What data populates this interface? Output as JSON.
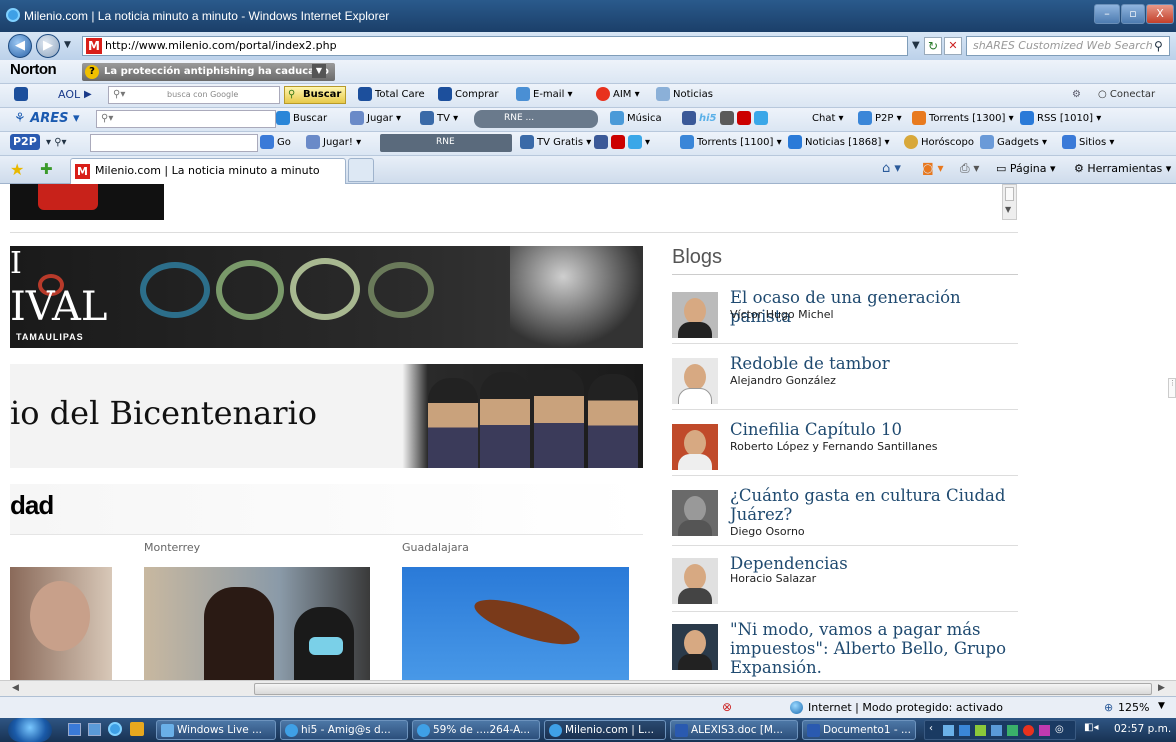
{
  "window": {
    "title": "Milenio.com | La noticia minuto a minuto - Windows Internet Explorer",
    "controls": [
      "–",
      "▫",
      "X"
    ]
  },
  "address": {
    "url": "http://www.milenio.com/portal/index2.php",
    "search_placeholder": "shARES Customized Web Search"
  },
  "toolbars": {
    "norton": {
      "brand": "Norton",
      "alert": "La protección antiphishing ha caducado"
    },
    "aol": {
      "brand": "AOL",
      "search_hint": "busca con Google",
      "search_button": "Buscar",
      "items": [
        "Total Care",
        "Comprar",
        "E-mail",
        "AIM",
        "Noticias"
      ],
      "connect": "Conectar"
    },
    "ares": {
      "brand": "ARES",
      "items": [
        "Buscar",
        "Jugar",
        "TV",
        "RNE ...",
        "Música",
        "Chat",
        "P2P",
        "Torrents [1300]",
        "RSS [1010]"
      ]
    },
    "p2p": {
      "brand": "P2P",
      "items": [
        "Go",
        "Jugar!",
        "RNE",
        "TV Gratis",
        "Torrents [1100]",
        "Noticias [1868]",
        "Horóscopo",
        "Gadgets",
        "Sitios"
      ]
    }
  },
  "tabbar": {
    "tab_title": "Milenio.com | La noticia minuto a minuto",
    "commands": [
      "Página",
      "Herramientas"
    ]
  },
  "page": {
    "banner1": {
      "text_top": "I",
      "text_main": "IVAL",
      "text_sub": "TAMAULIPAS"
    },
    "banner2": {
      "text": "io del Bicentenario"
    },
    "section": {
      "title": "dad"
    },
    "cities": [
      "Monterrey",
      "Guadalajara"
    ],
    "blogs": {
      "title": "Blogs",
      "entries": [
        {
          "title": "El ocaso de una generación panista",
          "author": "Víctor Hugo Michel"
        },
        {
          "title": "Redoble de tambor",
          "author": "Alejandro González"
        },
        {
          "title": "Cinefilia Capítulo 10",
          "author": "Roberto López y Fernando Santillanes"
        },
        {
          "title": "¿Cuánto gasta en cultura Ciudad Juárez?",
          "author": "Diego Osorno"
        },
        {
          "title": "Dependencias",
          "author": "Horacio Salazar"
        },
        {
          "title": "\"Ni modo, vamos a pagar más impuestos\": Alberto Bello, Grupo Expansión.",
          "author": ""
        }
      ]
    }
  },
  "statusbar": {
    "zone": "Internet | Modo protegido: activado",
    "zoom": "125%"
  },
  "taskbar": {
    "items": [
      "Windows Live ...",
      "hi5 - Amig@s d...",
      "59% de ....264-A...",
      "Milenio.com | L...",
      "ALEXIS3.doc [M...",
      "Documento1 - ..."
    ],
    "clock": "02:57 p.m."
  }
}
